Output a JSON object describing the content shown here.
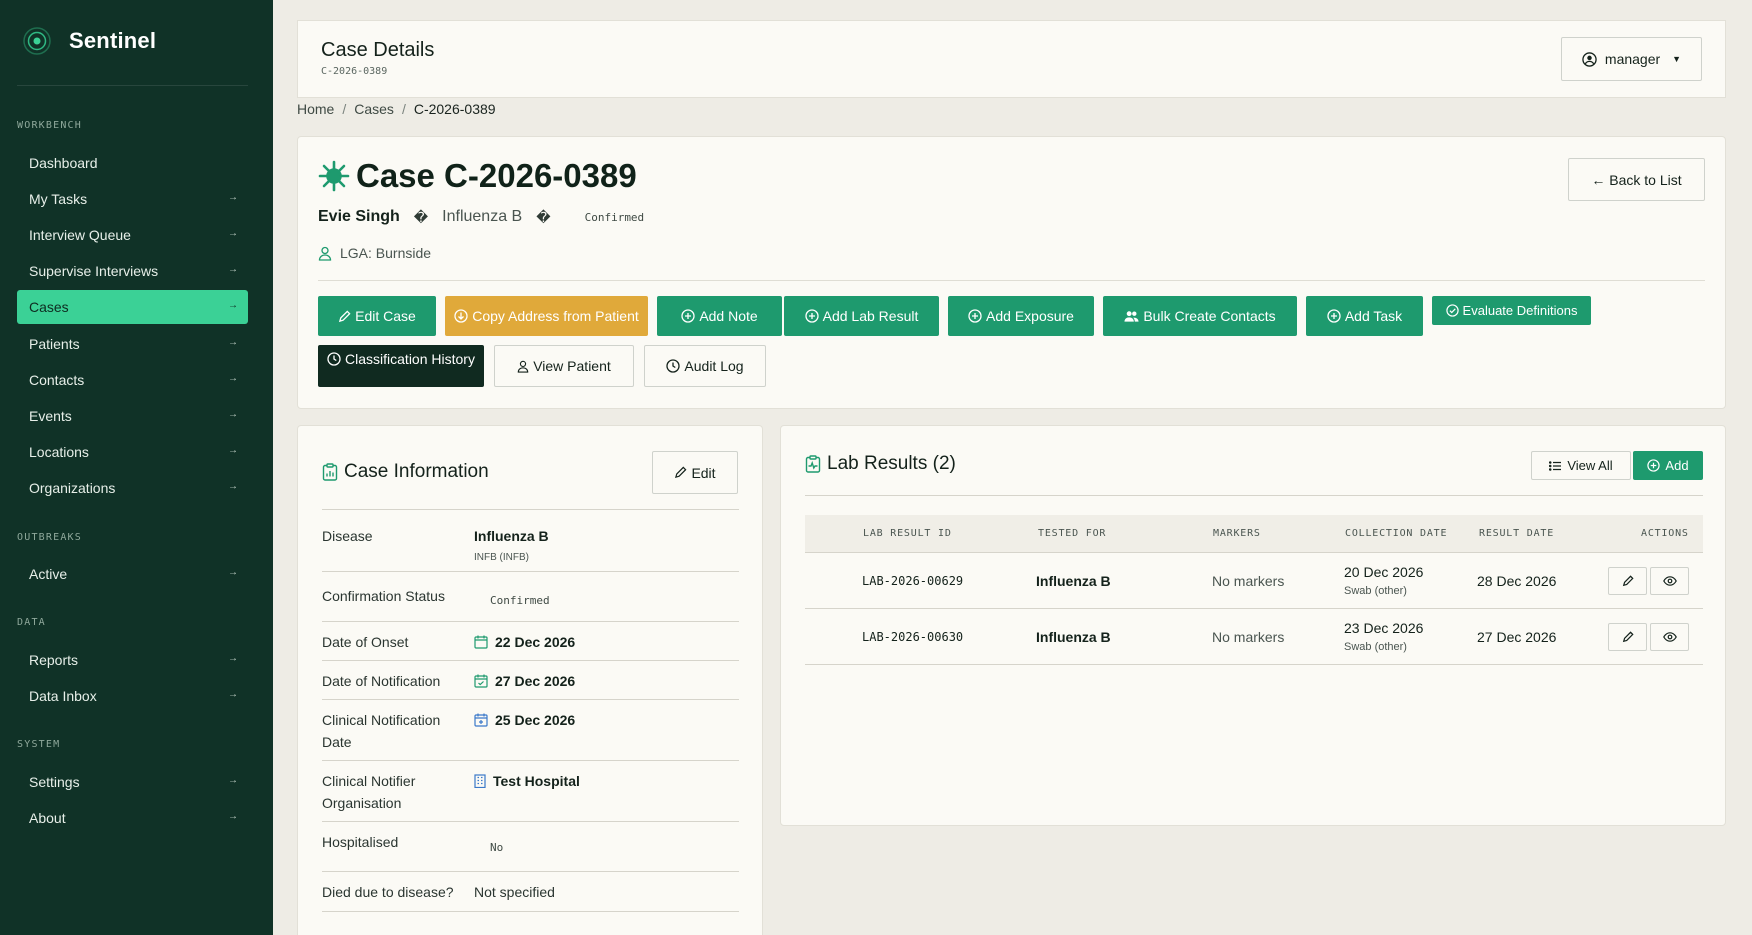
{
  "app": {
    "name": "Sentinel",
    "logo_icon": "radar-target-icon"
  },
  "sidebar": {
    "sections": [
      {
        "title": "WORKBENCH",
        "items": [
          {
            "label": "Dashboard",
            "active": false
          },
          {
            "label": "My Tasks",
            "active": false
          },
          {
            "label": "Interview Queue",
            "active": false
          },
          {
            "label": "Supervise Interviews",
            "active": false
          },
          {
            "label": "Cases",
            "active": true
          },
          {
            "label": "Patients",
            "active": false
          },
          {
            "label": "Contacts",
            "active": false
          },
          {
            "label": "Events",
            "active": false
          },
          {
            "label": "Locations",
            "active": false
          },
          {
            "label": "Organizations",
            "active": false
          }
        ]
      },
      {
        "title": "OUTBREAKS",
        "items": [
          {
            "label": "Active",
            "active": false
          }
        ]
      },
      {
        "title": "DATA",
        "items": [
          {
            "label": "Reports",
            "active": false
          },
          {
            "label": "Data Inbox",
            "active": false
          }
        ]
      },
      {
        "title": "SYSTEM",
        "items": [
          {
            "label": "Settings",
            "active": false
          },
          {
            "label": "About",
            "active": false
          }
        ]
      }
    ],
    "arrow_glyph": "→"
  },
  "header": {
    "title": "Case Details",
    "subtitle": "C-2026-0389",
    "user_label": "manager",
    "user_icon": "user-circle-icon"
  },
  "breadcrumb": {
    "items": [
      "Home",
      "Cases",
      "C-2026-0389"
    ],
    "separator": "/"
  },
  "case": {
    "title": "Case C-2026-0389",
    "title_icon": "virus-icon",
    "back_label": "← Back to List",
    "patient_name": "Evie Singh",
    "disease": "Influenza B",
    "status": "Confirmed",
    "meta_separator": "�",
    "lga": "LGA: Burnside",
    "actions": [
      {
        "label": "Edit Case",
        "icon": "pencil-icon",
        "style": "green"
      },
      {
        "label": "Copy Address from Patient",
        "icon": "download-circle-icon",
        "style": "amber"
      },
      {
        "label": "Add Note",
        "icon": "plus-circle-icon",
        "style": "green"
      },
      {
        "label": "Add Lab Result",
        "icon": "plus-circle-icon",
        "style": "green"
      },
      {
        "label": "Add Exposure",
        "icon": "plus-circle-icon",
        "style": "green"
      },
      {
        "label": "Bulk Create Contacts",
        "icon": "people-icon",
        "style": "green"
      },
      {
        "label": "Add Task",
        "icon": "plus-circle-icon",
        "style": "green"
      },
      {
        "label": "Evaluate Definitions",
        "icon": "check-circle-icon",
        "style": "green"
      },
      {
        "label": "Classification History",
        "icon": "clock-icon",
        "style": "dark"
      },
      {
        "label": "View Patient",
        "icon": "person-icon",
        "style": "outline"
      },
      {
        "label": "Audit Log",
        "icon": "clock-icon",
        "style": "outline"
      }
    ]
  },
  "case_info": {
    "title": "Case Information",
    "edit_label": "Edit",
    "rows": [
      {
        "label": "Disease",
        "value": "Influenza B",
        "sub": "INFB (INFB)"
      },
      {
        "label": "Confirmation Status",
        "value": "Confirmed"
      },
      {
        "label": "Date of Onset",
        "value": "22 Dec 2026",
        "icon": "calendar-icon"
      },
      {
        "label": "Date of Notification",
        "value": "27 Dec 2026",
        "icon": "calendar-check-icon"
      },
      {
        "label": "Clinical Notification Date",
        "value": "25 Dec 2026",
        "icon": "calendar-plus-icon"
      },
      {
        "label": "Clinical Notifier Organisation",
        "value": "Test Hospital",
        "icon": "building-icon"
      },
      {
        "label": "Hospitalised",
        "value": "No"
      },
      {
        "label": "Died due to disease?",
        "value": "Not specified"
      }
    ]
  },
  "lab_results": {
    "title": "Lab Results (2)",
    "view_all_label": "View All",
    "add_label": "Add",
    "columns": [
      "LAB RESULT ID",
      "TESTED FOR",
      "MARKERS",
      "COLLECTION DATE",
      "RESULT DATE",
      "ACTIONS"
    ],
    "rows": [
      {
        "id": "LAB-2026-00629",
        "tested_for": "Influenza B",
        "markers": "No markers",
        "collection_date": "20 Dec 2026",
        "specimen": "Swab (other)",
        "result_date": "28 Dec 2026"
      },
      {
        "id": "LAB-2026-00630",
        "tested_for": "Influenza B",
        "markers": "No markers",
        "collection_date": "23 Dec 2026",
        "specimen": "Swab (other)",
        "result_date": "27 Dec 2026"
      }
    ]
  },
  "colors": {
    "sidebar_bg": "#103227",
    "active_nav": "#3bd196",
    "primary": "#1e9a6e",
    "amber": "#e0a93a",
    "dark": "#102a20",
    "page_bg": "#eeece5",
    "card_bg": "#fbfaf5"
  }
}
